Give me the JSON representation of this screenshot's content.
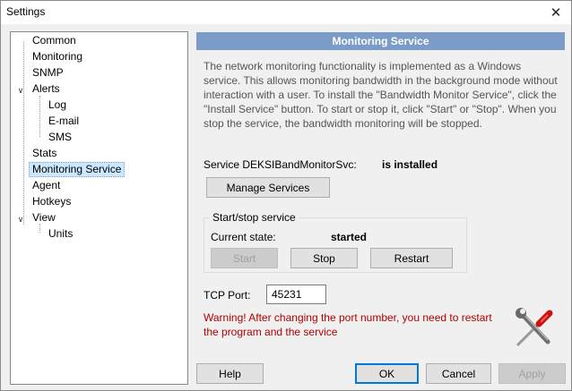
{
  "window": {
    "title": "Settings",
    "close_glyph": "✕"
  },
  "tree": {
    "items": [
      {
        "label": "Common",
        "selected": false
      },
      {
        "label": "Monitoring",
        "selected": false
      },
      {
        "label": "SNMP",
        "selected": false
      },
      {
        "label": "Alerts",
        "selected": false,
        "expanded": true
      },
      {
        "label": "Log",
        "selected": false
      },
      {
        "label": "E-mail",
        "selected": false
      },
      {
        "label": "SMS",
        "selected": false
      },
      {
        "label": "Stats",
        "selected": false
      },
      {
        "label": "Monitoring Service",
        "selected": true
      },
      {
        "label": "Agent",
        "selected": false
      },
      {
        "label": "Hotkeys",
        "selected": false
      },
      {
        "label": "View",
        "selected": false,
        "expanded": true
      },
      {
        "label": "Units",
        "selected": false
      }
    ]
  },
  "panel": {
    "header": "Monitoring Service",
    "description": "The network monitoring functionality is implemented as a Windows service. This allows monitoring bandwidth in the background mode without interaction with a user. To install the \"Bandwidth Monitor Service\", click the \"Install Service\" button. To start or stop it, click \"Start\" or \"Stop\". When you stop the service, the bandwidth monitoring will be stopped.",
    "service_label": "Service DEKSIBandMonitorSvc:",
    "service_status": "is installed",
    "manage_services_label": "Manage Services",
    "group_title": "Start/stop service",
    "current_state_label": "Current state:",
    "current_state_value": "started",
    "start_label": "Start",
    "stop_label": "Stop",
    "restart_label": "Restart",
    "tcp_port_label": "TCP Port:",
    "tcp_port_value": "45231",
    "warning": "Warning! After changing the port number, you need to restart the program and the service",
    "icon": "tools-icon"
  },
  "footer": {
    "help_label": "Help",
    "ok_label": "OK",
    "cancel_label": "Cancel",
    "apply_label": "Apply"
  },
  "colors": {
    "header_bg": "#7a9cc6",
    "selection_bg": "#cce8ff",
    "warning_text": "#b00000",
    "default_button_border": "#0078d7"
  }
}
